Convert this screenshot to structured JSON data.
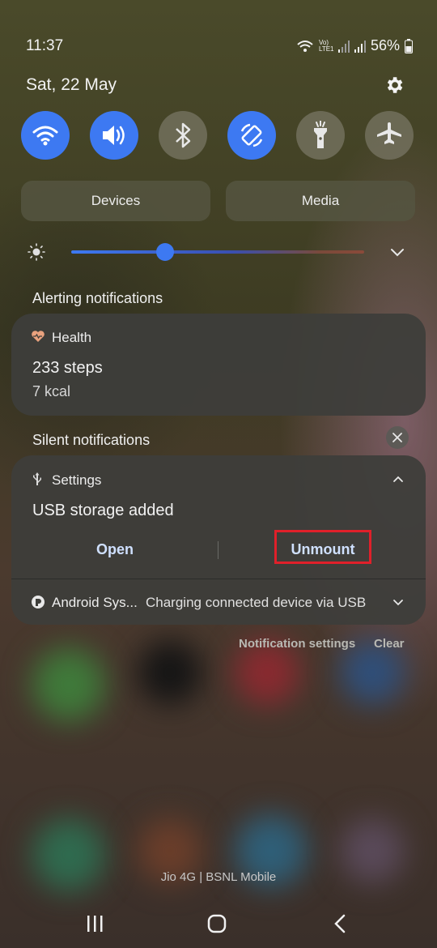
{
  "status_bar": {
    "time": "11:37",
    "battery": "56%",
    "volte_label": "Vo) LTE1"
  },
  "panel": {
    "date": "Sat, 22 May",
    "quick_settings": [
      {
        "name": "wifi-icon",
        "state": "on"
      },
      {
        "name": "sound-icon",
        "state": "on"
      },
      {
        "name": "bluetooth-icon",
        "state": "off"
      },
      {
        "name": "auto-rotate-icon",
        "state": "on"
      },
      {
        "name": "flashlight-icon",
        "state": "off"
      },
      {
        "name": "airplane-mode-icon",
        "state": "off"
      }
    ],
    "devices_label": "Devices",
    "media_label": "Media",
    "brightness_level": 0.32
  },
  "notifications": {
    "alerting_title": "Alerting notifications",
    "health": {
      "app": "Health",
      "title": "233 steps",
      "subtitle": "7 kcal"
    },
    "silent_title": "Silent notifications",
    "settings": {
      "app": "Settings",
      "title": "USB storage added",
      "open_label": "Open",
      "unmount_label": "Unmount"
    },
    "android_system": {
      "app": "Android Sys...",
      "text": "Charging connected device via USB"
    },
    "notification_settings_label": "Notification settings",
    "clear_label": "Clear"
  },
  "carrier": "Jio 4G | BSNL Mobile",
  "colors": {
    "accent": "#3d79f2",
    "highlight_box": "#e0202a"
  }
}
